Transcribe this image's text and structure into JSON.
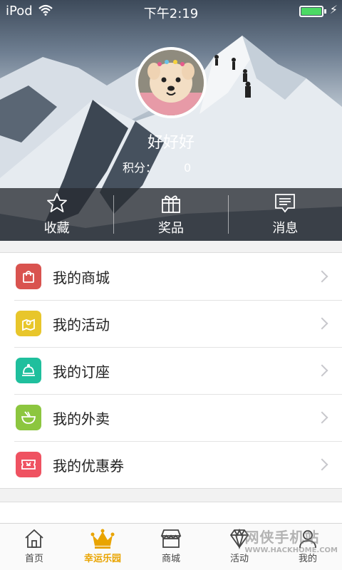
{
  "status": {
    "carrier": "iPod",
    "time": "下午2:19",
    "battery_level": 1.0
  },
  "profile": {
    "username": "好好好",
    "points_label": "积分：",
    "points_value": "0"
  },
  "quick_actions": [
    {
      "label": "收藏",
      "icon": "star-icon"
    },
    {
      "label": "奖品",
      "icon": "gift-icon"
    },
    {
      "label": "消息",
      "icon": "message-icon"
    }
  ],
  "menu": [
    {
      "label": "我的商城",
      "icon": "shopping-bag-icon",
      "color": "#d9534f"
    },
    {
      "label": "我的活动",
      "icon": "map-pin-icon",
      "color": "#e8c62b"
    },
    {
      "label": "我的订座",
      "icon": "cloche-icon",
      "color": "#1fbf9d"
    },
    {
      "label": "我的外卖",
      "icon": "bowl-icon",
      "color": "#8cc63f"
    },
    {
      "label": "我的优惠券",
      "icon": "ticket-icon",
      "color": "#ef5261"
    }
  ],
  "tabs": [
    {
      "label": "首页",
      "icon": "home-icon"
    },
    {
      "label": "幸运乐园",
      "icon": "crown-icon",
      "active": true
    },
    {
      "label": "商城",
      "icon": "store-icon"
    },
    {
      "label": "活动",
      "icon": "diamond-icon"
    },
    {
      "label": "我的",
      "icon": "person-icon"
    }
  ],
  "watermark": {
    "text": "网侠手机站",
    "url": "WWW.HACKHOME.COM"
  },
  "colors": {
    "accent": "#e9a400",
    "battery": "#4cd964"
  }
}
